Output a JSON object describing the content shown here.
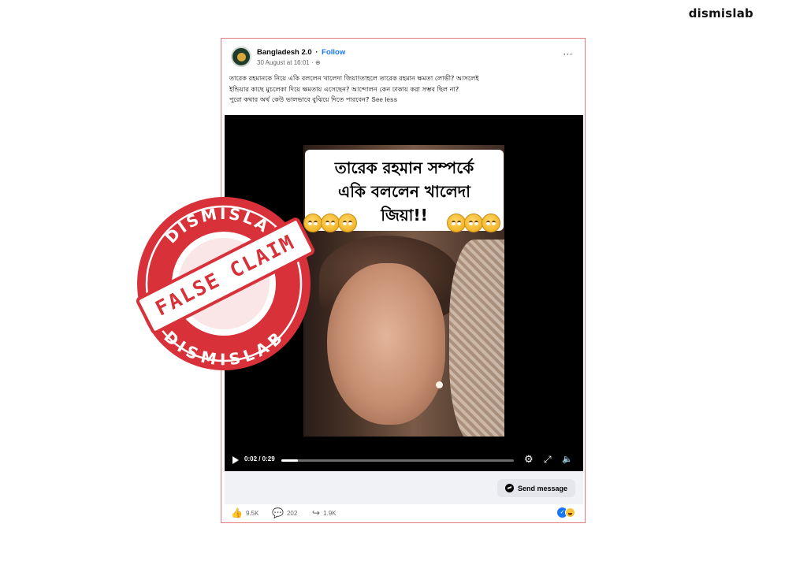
{
  "watermark": {
    "brand": "dismislab"
  },
  "post": {
    "page_name": "Bangladesh 2.0",
    "separator": "·",
    "follow_label": "Follow",
    "timestamp": "30 August at 16:01 ·",
    "globe_icon": "globe-icon",
    "more_icon": "⋯",
    "caption_line1": "তারেক রহমানকে নিয়ে একি বললেন খালেদা জিয়া!তাহলে তারেক রহমান ক্ষমতা লোভী? আসলেই",
    "caption_line2": "ইন্ডিয়ার কাছে মুচলেকা দিয়ে ক্ষমতায় এসেছেন? আন্দোলন কেন ঢাকায় করা সম্ভব ছিল না?",
    "caption_line3": "পুরো কথার অর্থ কেউ ভালভাবে বুঝিয়ে দিতে পারবেন?",
    "see_less": "See less"
  },
  "video": {
    "overlay_line1": "তারেক রহমান সম্পর্কে",
    "overlay_line2": "একি বললেন খালেদা",
    "overlay_line3": "জিয়া!!",
    "time": "0:02 / 0:29",
    "progress_fraction": 0.07,
    "gear_glyph": "⚙",
    "expand_glyph": "⤢",
    "volume_glyph": "🔈"
  },
  "cta": {
    "send_message": "Send message"
  },
  "stats": {
    "likes": "9.5K",
    "comments": "202",
    "shares": "1.9K",
    "like_glyph": "👍",
    "comment_glyph": "💬",
    "share_glyph": "↪"
  },
  "stamp": {
    "top_text": "DISMISLAB",
    "bottom_text": "DISMISLAB",
    "banner_text": "FALSE CLAIM",
    "color": "#d8313a"
  }
}
